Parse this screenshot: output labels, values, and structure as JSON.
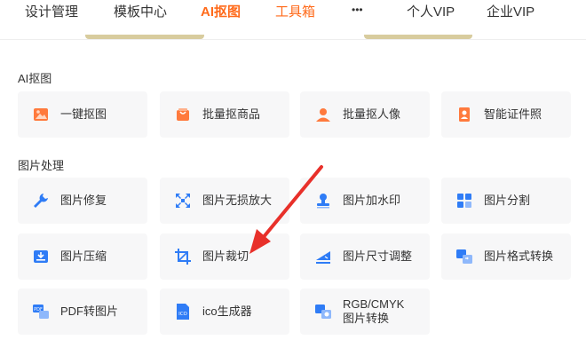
{
  "nav": {
    "items": [
      {
        "label": "设计管理"
      },
      {
        "label": "模板中心"
      },
      {
        "label": "AI抠图"
      },
      {
        "label": "工具箱"
      },
      {
        "label": "•••"
      },
      {
        "label": "个人VIP"
      },
      {
        "label": "企业VIP"
      }
    ]
  },
  "sections": [
    {
      "title": "AI抠图",
      "tiles": [
        {
          "label": "一键抠图",
          "icon": "image-cutout-icon"
        },
        {
          "label": "批量抠商品",
          "icon": "shopping-bag-icon"
        },
        {
          "label": "批量抠人像",
          "icon": "portrait-icon"
        },
        {
          "label": "智能证件照",
          "icon": "id-photo-icon"
        }
      ]
    },
    {
      "title": "图片处理",
      "tiles": [
        {
          "label": "图片修复",
          "icon": "wrench-icon"
        },
        {
          "label": "图片无损放大",
          "icon": "enlarge-icon"
        },
        {
          "label": "图片加水印",
          "icon": "watermark-stamp-icon"
        },
        {
          "label": "图片分割",
          "icon": "grid-split-icon"
        },
        {
          "label": "图片压缩",
          "icon": "compress-icon"
        },
        {
          "label": "图片裁切",
          "icon": "crop-icon"
        },
        {
          "label": "图片尺寸调整",
          "icon": "resize-icon"
        },
        {
          "label": "图片格式转换",
          "icon": "format-convert-icon"
        },
        {
          "label": "PDF转图片",
          "icon": "pdf-icon"
        },
        {
          "label": "ico生成器",
          "icon": "ico-file-icon"
        },
        {
          "label": "RGB/CMYK\n图片转换",
          "icon": "color-convert-icon"
        }
      ]
    }
  ],
  "colors": {
    "accent": "#ff6a1a",
    "icon_blue": "#2f7cf6",
    "icon_orange": "#ff7a3d",
    "tile_bg": "#f7f7f8",
    "annotation_arrow": "#e8302a"
  }
}
